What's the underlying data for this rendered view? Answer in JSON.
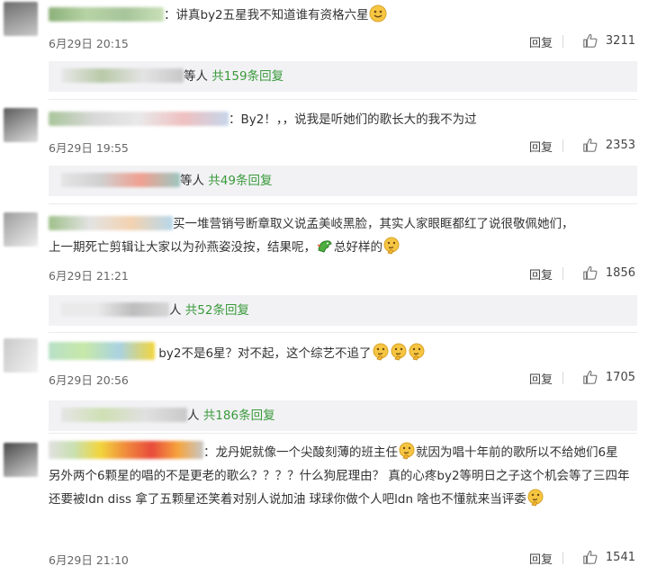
{
  "comments": [
    {
      "text": "：讲真by2五星我不知道谁有资格六星",
      "time": "6月29日 20:15",
      "reply_label": "回复",
      "likes": "3211",
      "sub_suffix": "等人",
      "sub_count": "共159条回复"
    },
    {
      "text": "：By2！，，说我是听她们的歌长大的我不为过",
      "time": "6月29日 19:55",
      "reply_label": "回复",
      "likes": "2353",
      "sub_suffix": "等人",
      "sub_count": "共49条回复"
    },
    {
      "line1": "买一堆营销号断章取义说孟美岐黑脸，其实人家眼眶都红了说很敬佩她们，",
      "line2a": "上一期死亡剪辑让大家以为孙燕姿没按，结果呢，",
      "line2b": "总好样的",
      "time": "6月29日 21:21",
      "reply_label": "回复",
      "likes": "1856",
      "sub_suffix": "人",
      "sub_count": "共52条回复"
    },
    {
      "text": "by2不是6星？对不起，这个综艺不追了",
      "time": "6月29日 20:56",
      "reply_label": "回复",
      "likes": "1705",
      "sub_suffix": "人",
      "sub_count": "共186条回复"
    },
    {
      "part1": "：龙丹妮就像一个尖酸刻薄的班主任",
      "part2": "就因为唱十年前的歌所以不给她们6星 另外两个6颗星的唱的不是更老的歌么？？？？什么狗屁理由？ 真的心疼by2等明日之子这个机会等了三四年 还要被ldn diss 拿了五颗星还笑着对别人说加油 球球你做个人吧ldn 啥也不懂就来当评委",
      "time": "6月29日 21:10",
      "reply_label": "回复",
      "likes": "1541"
    }
  ],
  "icons": {
    "like": "thumbs-up-icon",
    "emoji_smile": "smile-emoji-icon",
    "emoji_think": "thinking-emoji-icon",
    "emoji_dragon": "dragon-emoji-icon"
  },
  "colors": {
    "reply_count": "#3a9a3a",
    "sub_bg": "#f2f2f5",
    "emoji_yellow": "#f6c542"
  }
}
